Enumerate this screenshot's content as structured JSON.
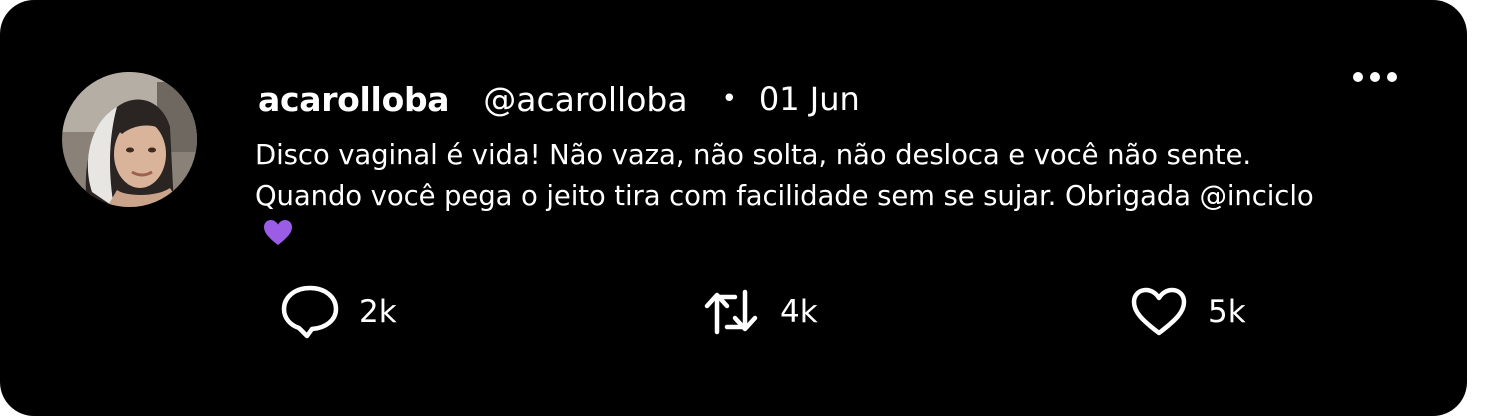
{
  "post": {
    "display_name": "acarolloba",
    "handle": "@acarolloba",
    "separator": "•",
    "date": "01 Jun",
    "text": "Disco vaginal é vida! Não vaza, não solta, não desloca e você não sente. Quando você pega o jeito tira com facilidade sem se sujar. Obrigada @inciclo",
    "emoji": "purple-heart",
    "more_icon": "more-horizontal-icon"
  },
  "actions": {
    "comments": {
      "icon": "comment-icon",
      "count": "2k"
    },
    "reposts": {
      "icon": "repost-icon",
      "count": "4k"
    },
    "likes": {
      "icon": "heart-icon",
      "count": "5k"
    }
  },
  "colors": {
    "card_background": "#000000",
    "text": "#ffffff",
    "emoji": "#9b5de5"
  }
}
